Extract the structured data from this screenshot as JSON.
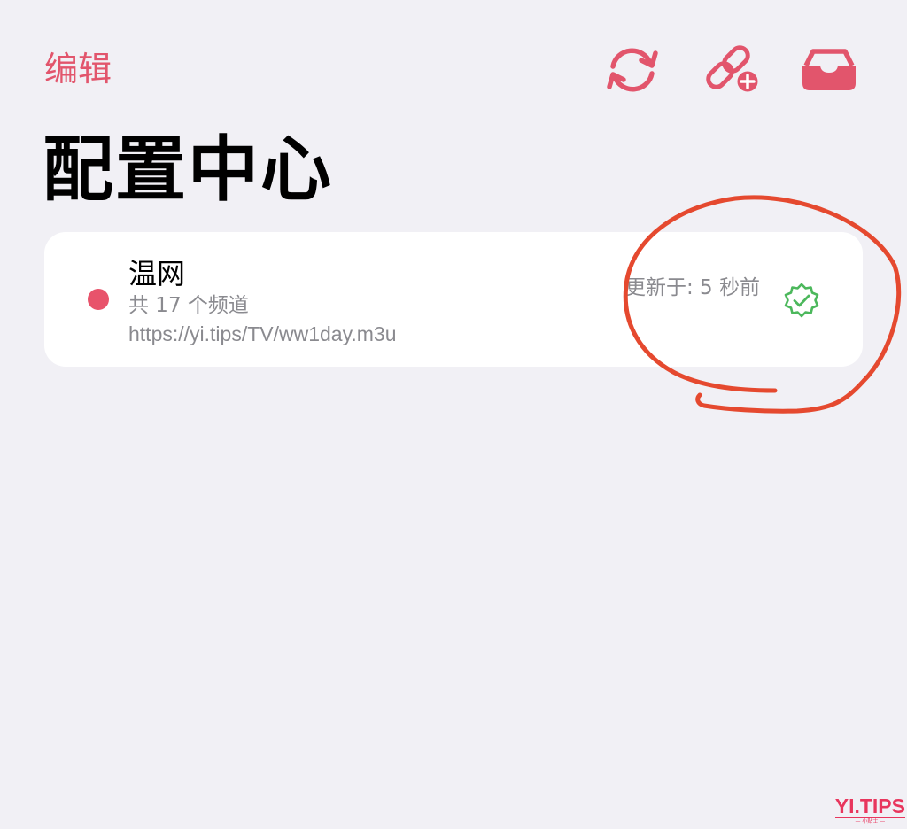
{
  "nav": {
    "edit_label": "编辑"
  },
  "icons": {
    "refresh": "refresh-icon",
    "link_add": "link-add-icon",
    "inbox": "inbox-icon",
    "verified": "verified-check-icon"
  },
  "page": {
    "title": "配置中心"
  },
  "config_card": {
    "name": "温网",
    "channel_count_text": "共 17 个频道",
    "url": "https://yi.tips/TV/ww1day.m3u",
    "updated_text": "更新于: 5 秒前",
    "status_color": "#e8536b",
    "verified_color": "#4cb85c"
  },
  "colors": {
    "accent": "#e2556c",
    "background": "#f1f0f5",
    "annotation": "#e5492f"
  },
  "watermark": {
    "logo_text": "YI.TIPS",
    "tagline": "— 小贴士 —"
  }
}
